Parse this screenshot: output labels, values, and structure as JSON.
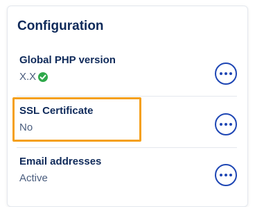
{
  "card": {
    "title": "Configuration",
    "rows": [
      {
        "label": "Global PHP version",
        "value": "X.X",
        "status_icon": "check-circle-icon",
        "status_color": "#2ea84a"
      },
      {
        "label": "SSL Certificate",
        "value": "No",
        "highlighted": true
      },
      {
        "label": "Email addresses",
        "value": "Active"
      }
    ],
    "more_icon": "more-horizontal-icon"
  },
  "colors": {
    "title": "#0f2a5a",
    "value": "#4a5d7e",
    "accent": "#1e46b4",
    "highlight": "#f5a01a",
    "success": "#2ea84a"
  }
}
